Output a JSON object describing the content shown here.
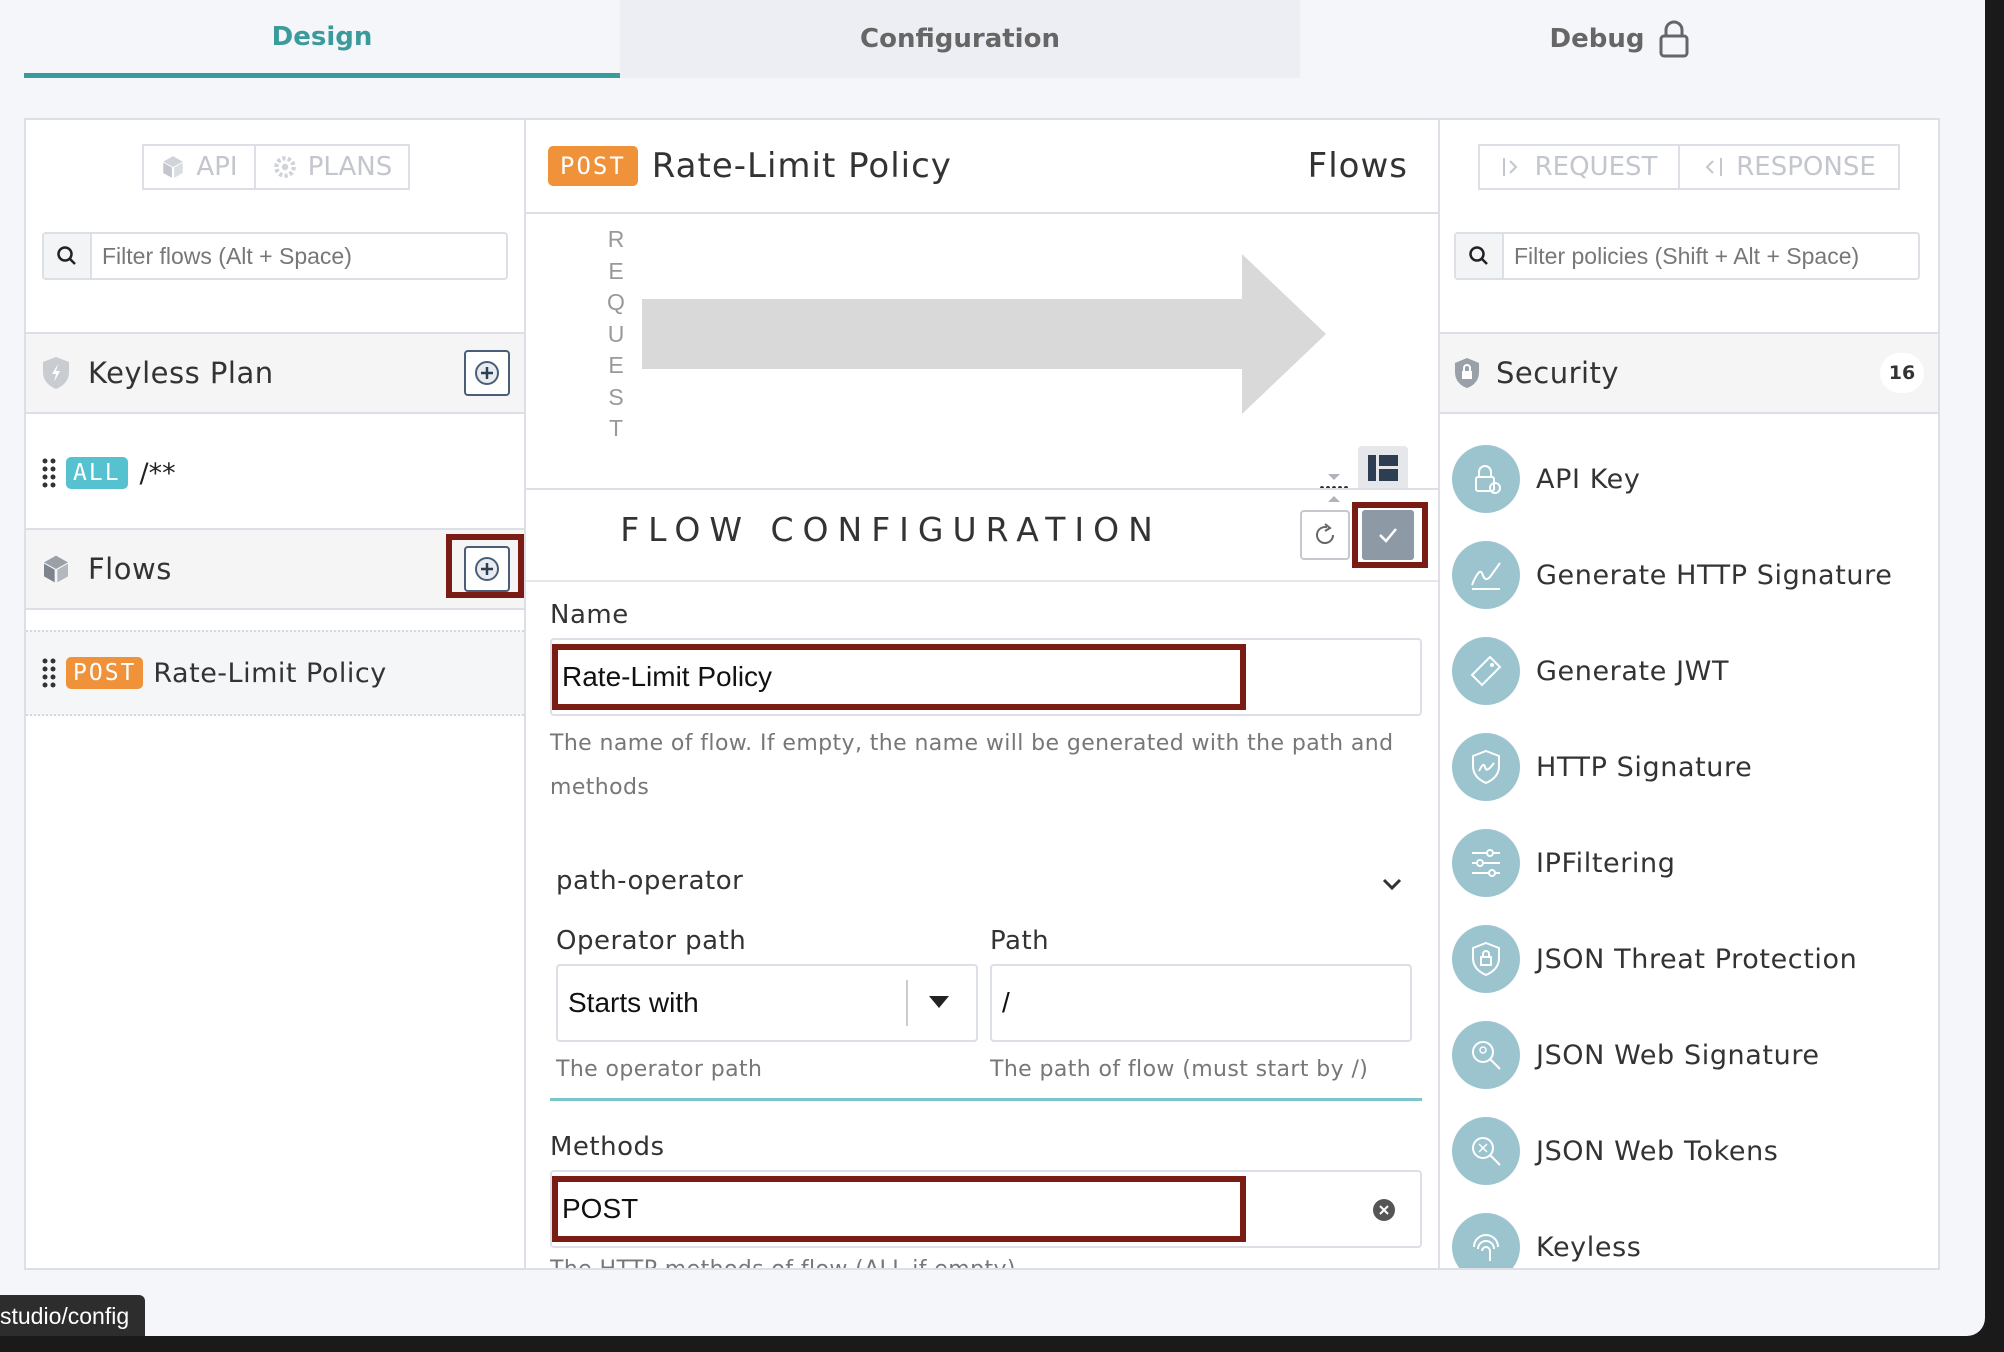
{
  "tabs": {
    "design": "Design",
    "configuration": "Configuration",
    "debug": "Debug"
  },
  "left": {
    "api_label": "API",
    "plans_label": "PLANS",
    "filter_placeholder": "Filter flows (Alt + Space)",
    "plan_title": "Keyless Plan",
    "plan_flow": {
      "method": "ALL",
      "path": "/**"
    },
    "flows_title": "Flows",
    "flows": [
      {
        "method": "POST",
        "name": "Rate-Limit Policy"
      }
    ]
  },
  "middle": {
    "method": "POST",
    "title": "Rate-Limit Policy",
    "flows_link": "Flows",
    "request_letters": [
      "R",
      "E",
      "Q",
      "U",
      "E",
      "S",
      "T"
    ],
    "flow_configuration": "FLOW CONFIGURATION",
    "name_label": "Name",
    "name_value": "Rate-Limit Policy",
    "name_help": "The name of flow. If empty, the name will be generated with the path and methods",
    "path_operator_label": "path-operator",
    "operator_path_label": "Operator path",
    "operator_path_value": "Starts with",
    "operator_path_help": "The operator path",
    "path_label": "Path",
    "path_value": "/",
    "path_help": "The path of flow (must start by /)",
    "methods_label": "Methods",
    "methods_value": "POST",
    "methods_help": "The HTTP methods of flow (ALL if empty)"
  },
  "right": {
    "request_label": "REQUEST",
    "response_label": "RESPONSE",
    "filter_placeholder": "Filter policies (Shift + Alt + Space)",
    "section_title": "Security",
    "section_count": "16",
    "policies": [
      {
        "name": "API Key",
        "icon": "api-key-icon"
      },
      {
        "name": "Generate HTTP Signature",
        "icon": "signature-pen-icon"
      },
      {
        "name": "Generate JWT",
        "icon": "tag-icon"
      },
      {
        "name": "HTTP Signature",
        "icon": "shield-signature-icon"
      },
      {
        "name": "IPFiltering",
        "icon": "sliders-icon"
      },
      {
        "name": "JSON Threat Protection",
        "icon": "shield-lock-icon"
      },
      {
        "name": "JSON Web Signature",
        "icon": "magnifier-key-icon"
      },
      {
        "name": "JSON Web Tokens",
        "icon": "magnifier-key-icon"
      },
      {
        "name": "Keyless",
        "icon": "fingerprint-icon"
      }
    ]
  },
  "status_url": "studio/config",
  "colors": {
    "accent": "#3b9a9c",
    "post": "#f0923a",
    "all": "#56c2cf",
    "highlight": "#7a1c14",
    "icon_bg": "#9cc4cf"
  }
}
